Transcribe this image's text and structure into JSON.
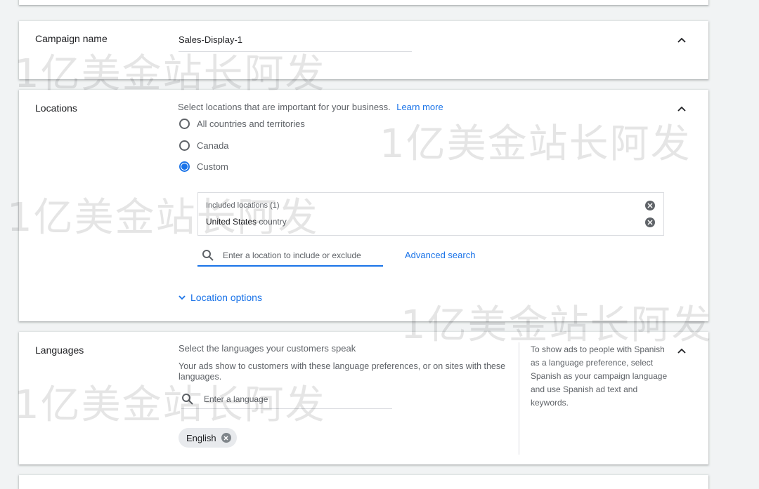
{
  "campaign": {
    "label": "Campaign name",
    "value": "Sales-Display-1"
  },
  "locations": {
    "label": "Locations",
    "description": "Select locations that are important for your business.",
    "learn_more": "Learn more",
    "options": [
      {
        "label": "All countries and territories",
        "checked": false
      },
      {
        "label": "Canada",
        "checked": false
      },
      {
        "label": "Custom",
        "checked": true
      }
    ],
    "included_header": "Included locations (1)",
    "included_item_name": "United States",
    "included_item_type": "country",
    "search_placeholder": "Enter a location to include or exclude",
    "advanced_search": "Advanced search",
    "location_options": "Location options"
  },
  "languages": {
    "label": "Languages",
    "description": "Select the languages your customers speak",
    "detail": "Your ads show to customers with these language preferences, or on sites with these languages.",
    "search_placeholder": "Enter a language",
    "chip": "English",
    "help_text": "To show ads to people with Spanish as a language preference, select Spanish as your campaign language and use Spanish ad text and keywords."
  },
  "watermark": "1亿美金站长阿发",
  "colors": {
    "accent": "#1a73e8",
    "background": "#f1f3f4",
    "card": "#ffffff",
    "muted_text": "#5f6368"
  }
}
